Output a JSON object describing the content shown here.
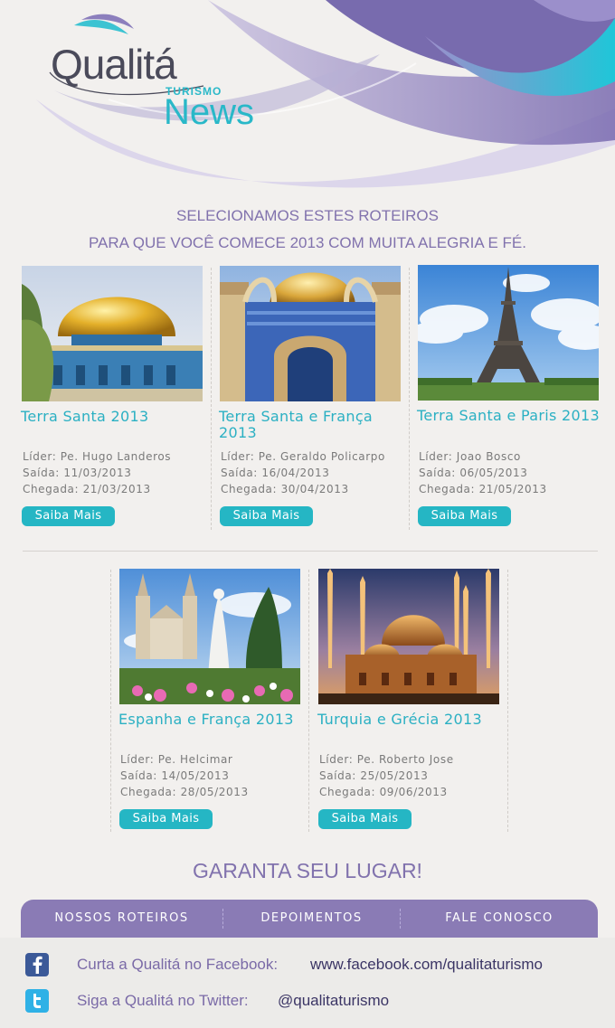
{
  "brand": {
    "name": "Qualitá",
    "sub": "TURISMO",
    "news": "News"
  },
  "intro": {
    "line1": "SELECIONAMOS ESTES ROTEIROS",
    "line2": "PARA QUE VOCÊ COMECE 2013 COM MUITA ALEGRIA E FÉ."
  },
  "trips": [
    {
      "title": "Terra Santa 2013",
      "leader": "Líder: Pe. Hugo Landeros",
      "departure": "Saída: 11/03/2013",
      "arrival": "Chegada: 21/03/2013",
      "button": "Saiba Mais",
      "image": "dome-of-the-rock-photo"
    },
    {
      "title": "Terra Santa e França 2013",
      "leader": "Líder: Pe. Geraldo Policarpo",
      "departure": "Saída: 16/04/2013",
      "arrival": "Chegada: 30/04/2013",
      "button": "Saiba Mais",
      "image": "dome-arches-photo"
    },
    {
      "title": "Terra Santa e Paris 2013",
      "leader": "Líder: Joao Bosco",
      "departure": "Saída: 06/05/2013",
      "arrival": "Chegada: 21/05/2013",
      "button": "Saiba Mais",
      "image": "eiffel-tower-photo"
    },
    {
      "title": "Espanha e França 2013",
      "leader": "Líder: Pe. Helcimar",
      "departure": "Saída: 14/05/2013",
      "arrival": "Chegada: 28/05/2013",
      "button": "Saiba Mais",
      "image": "medjugorje-church-photo"
    },
    {
      "title": "Turquia e Grécia 2013",
      "leader": "Líder: Pe. Roberto Jose",
      "departure": "Saída: 25/05/2013",
      "arrival": "Chegada: 09/06/2013",
      "button": "Saiba Mais",
      "image": "blue-mosque-photo"
    }
  ],
  "cta": "GARANTA SEU LUGAR!",
  "nav": [
    {
      "label": "NOSSOS ROTEIROS"
    },
    {
      "label": "DEPOIMENTOS"
    },
    {
      "label": "FALE CONOSCO"
    }
  ],
  "social": {
    "facebook": {
      "label": "Curta a Qualitá no Facebook:",
      "value": "www.facebook.com/qualitaturismo",
      "icon": "facebook-icon"
    },
    "twitter": {
      "label": "Siga a Qualitá no Twitter:",
      "value": "@qualitaturismo",
      "icon": "twitter-icon"
    }
  },
  "colors": {
    "accent": "#2bb0c3",
    "purple": "#8172ad",
    "nav": "#8a7bb5",
    "background": "#f2f0ee"
  }
}
